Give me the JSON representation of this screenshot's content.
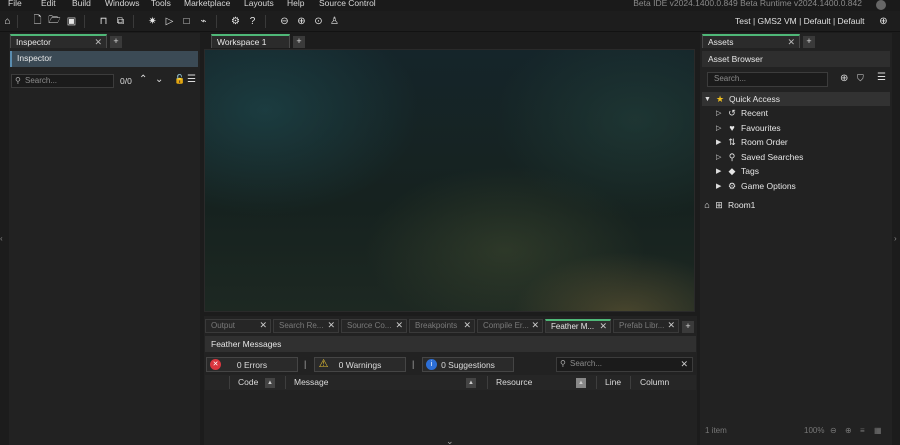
{
  "menu": [
    "File",
    "Edit",
    "Build",
    "Windows",
    "Tools",
    "Marketplace",
    "Layouts",
    "Help",
    "Source Control"
  ],
  "version_text": "Beta IDE v2024.1400.0.849 Beta Runtime v2024.1400.0.842",
  "toolbar": {
    "target": "Test  |  GMS2 VM  |  Default  |  Default",
    "icons": [
      "home-icon",
      "new-icon",
      "open-icon",
      "save-icon",
      "package-icon",
      "export-icon",
      "debug-icon",
      "play-icon",
      "stop-icon",
      "clean-icon",
      "settings-icon",
      "help-icon",
      "zoom-out-icon",
      "zoom-in-icon",
      "zoom-reset-icon",
      "gamepad-icon",
      "target-icon"
    ]
  },
  "inspector": {
    "tab_label": "Inspector",
    "header": "Inspector",
    "search_placeholder": "Search...",
    "count": "0/0"
  },
  "workspace": {
    "tab_label": "Workspace 1"
  },
  "output": {
    "tabs": [
      "Output",
      "Search Re...",
      "Source Co...",
      "Breakpoints",
      "Compile Er...",
      "Feather M...",
      "Prefab Libr..."
    ],
    "active_tab": "Feather M...",
    "panel_title": "Feather Messages",
    "errors_label": "0 Errors",
    "warnings_label": "0 Warnings",
    "suggestions_label": "0 Suggestions",
    "search_placeholder": "Search...",
    "columns": [
      "Code",
      "Message",
      "Resource",
      "Line",
      "Column"
    ]
  },
  "assets": {
    "tab_label": "Assets",
    "header": "Asset Browser",
    "search_placeholder": "Search...",
    "quick_access": "Quick Access",
    "items": [
      "Recent",
      "Favourites",
      "Room Order",
      "Saved Searches",
      "Tags",
      "Game Options"
    ],
    "room": "Room1",
    "status_items": "1 item",
    "zoom": "100%"
  },
  "colors": {
    "accent_green": "#4fb878",
    "error_red": "#d9363e",
    "warning_yellow": "#e8c232",
    "info_blue": "#2d6fd6"
  }
}
